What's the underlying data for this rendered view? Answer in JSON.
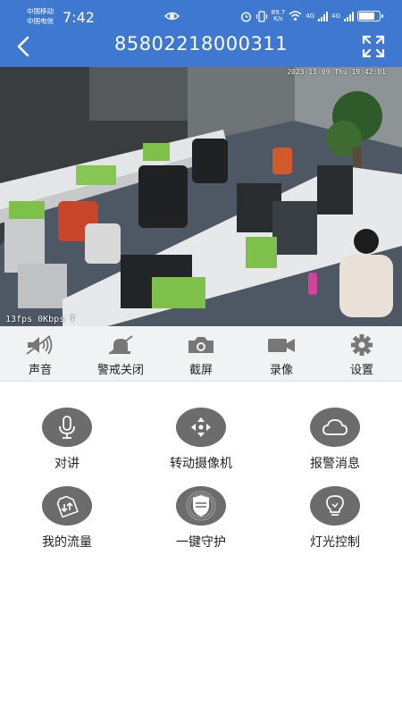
{
  "status_bar": {
    "carrier_1": "中国移动",
    "carrier_2": "中国电信",
    "time": "7:42",
    "net_speed_value": "89.7",
    "net_speed_unit": "K/s",
    "signal_1": "4G",
    "signal_2": "4G",
    "battery_level": 0.7
  },
  "header": {
    "title": "85802218000311"
  },
  "video": {
    "osd_timestamp": "2023-11-09 Thu 19:42:01",
    "stream_info": "13fps 0Kbps T"
  },
  "toolbar": [
    {
      "label": "声音",
      "icon": "speaker-muted-icon"
    },
    {
      "label": "警戒关闭",
      "icon": "alarm-siren-off-icon"
    },
    {
      "label": "截屏",
      "icon": "camera-icon"
    },
    {
      "label": "录像",
      "icon": "video-camera-icon"
    },
    {
      "label": "设置",
      "icon": "gear-icon"
    }
  ],
  "functions": [
    {
      "label": "对讲",
      "icon": "microphone-icon"
    },
    {
      "label": "转动摄像机",
      "icon": "direction-pad-icon"
    },
    {
      "label": "报警消息",
      "icon": "cloud-icon"
    },
    {
      "label": "我的流量",
      "icon": "data-traffic-icon"
    },
    {
      "label": "一键守护",
      "icon": "shield-icon"
    },
    {
      "label": "灯光控制",
      "icon": "light-bulb-icon"
    }
  ],
  "colors": {
    "header_blue": "#3f78d0",
    "toolbar_bg": "#f1f2f4",
    "function_icon_bg": "#6c6c6c"
  }
}
